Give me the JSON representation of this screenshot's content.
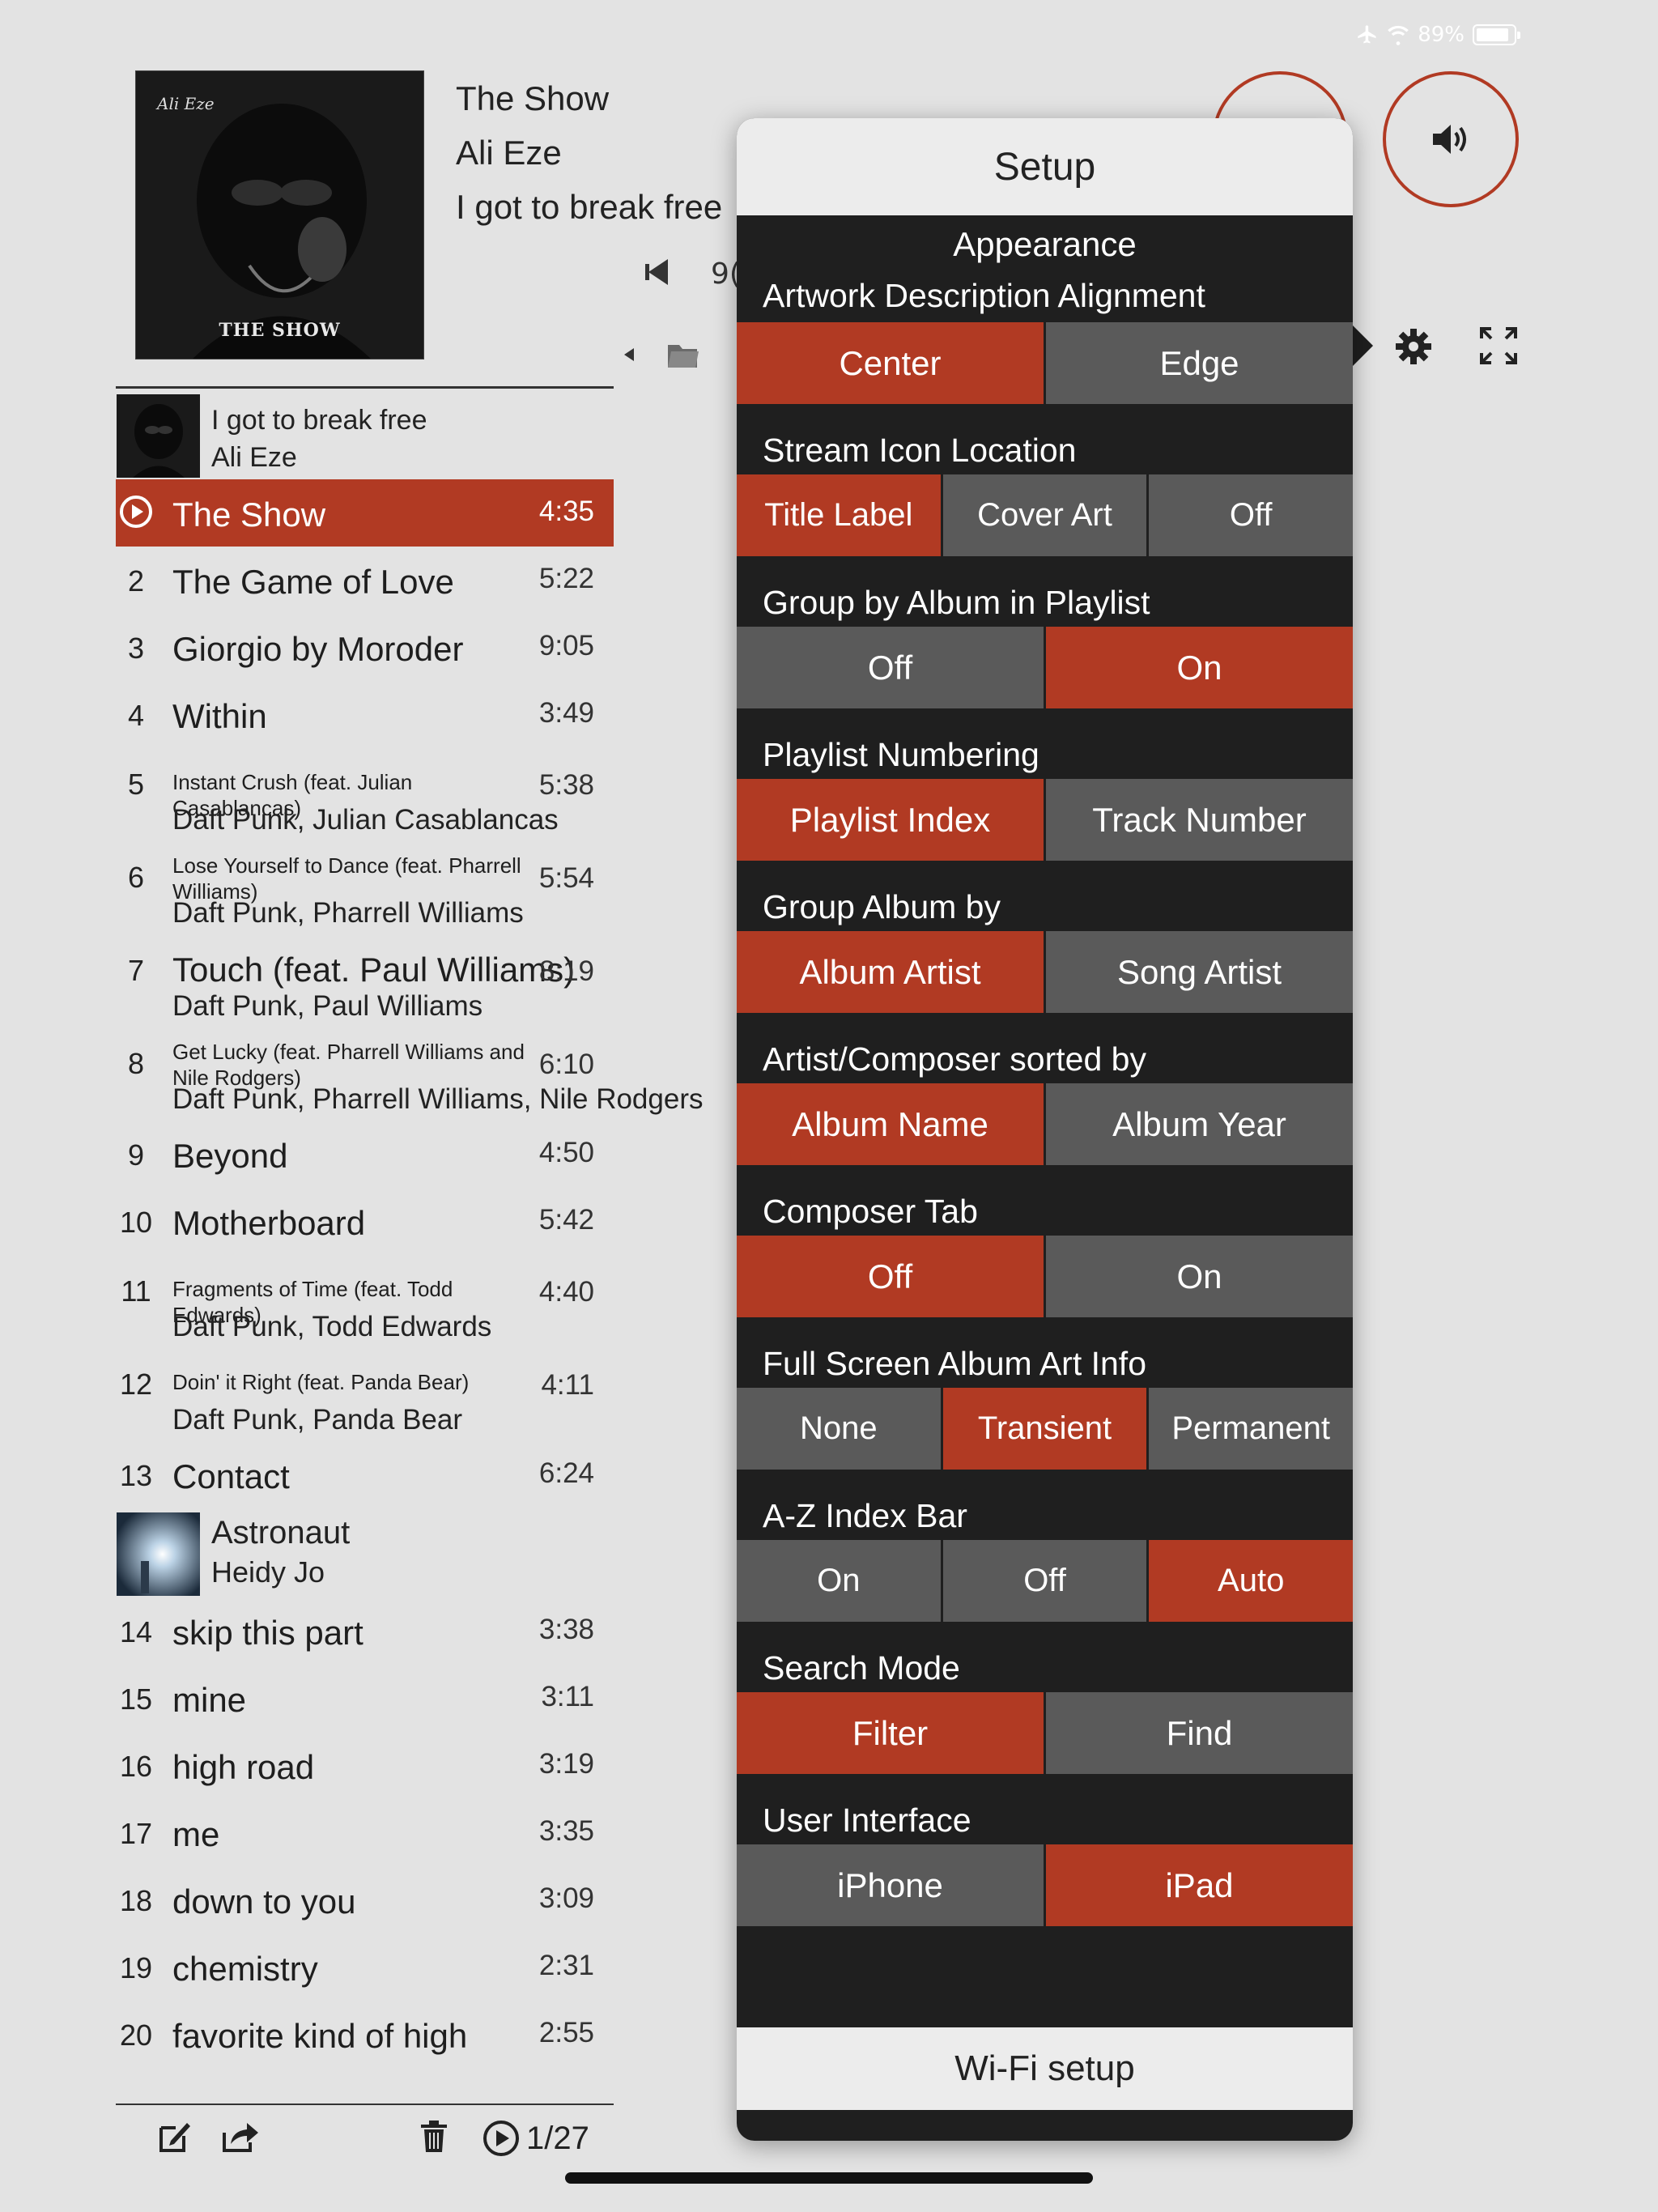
{
  "status": {
    "battery": "89%",
    "battery_level": 0.89,
    "icons": [
      "airplane-icon",
      "wifi-icon",
      "battery-icon"
    ]
  },
  "now_playing": {
    "title": "The Show",
    "artist": "Ali Eze",
    "album": "I got to break free",
    "partial_text": "9(",
    "cover_signature": "Ali Eze",
    "cover_caption": "THE SHOW"
  },
  "setup": {
    "title": "Setup",
    "appearance_label": "Appearance",
    "sections": [
      {
        "title": "Artwork Description Alignment",
        "options": [
          "Center",
          "Edge"
        ],
        "selected": 0
      },
      {
        "title": "Stream Icon Location",
        "options": [
          "Title Label",
          "Cover Art",
          "Off"
        ],
        "selected": 0
      },
      {
        "title": "Group by Album in Playlist",
        "options": [
          "Off",
          "On"
        ],
        "selected": 1
      },
      {
        "title": "Playlist Numbering",
        "options": [
          "Playlist Index",
          "Track Number"
        ],
        "selected": 0
      },
      {
        "title": "Group Album by",
        "options": [
          "Album Artist",
          "Song Artist"
        ],
        "selected": 0
      },
      {
        "title": "Artist/Composer sorted by",
        "options": [
          "Album Name",
          "Album Year"
        ],
        "selected": 0
      },
      {
        "title": "Composer Tab",
        "options": [
          "Off",
          "On"
        ],
        "selected": 0
      },
      {
        "title": "Full Screen Album Art Info",
        "options": [
          "None",
          "Transient",
          "Permanent"
        ],
        "selected": 1
      },
      {
        "title": "A-Z Index Bar",
        "options": [
          "On",
          "Off",
          "Auto"
        ],
        "selected": 2
      },
      {
        "title": "Search Mode",
        "options": [
          "Filter",
          "Find"
        ],
        "selected": 0
      },
      {
        "title": "User Interface",
        "options": [
          "iPhone",
          "iPad"
        ],
        "selected": 1
      }
    ],
    "wifi_label": "Wi-Fi setup"
  },
  "playlist": {
    "albums": [
      {
        "title": "I got to break free",
        "artist": "Ali Eze"
      },
      {
        "title": "Astronaut",
        "artist": "Heidy Jo"
      }
    ],
    "tracks": [
      {
        "num": "",
        "title": "The Show",
        "dur": "4:35",
        "current": true
      },
      {
        "num": "2",
        "title": "The Game of Love",
        "dur": "5:22"
      },
      {
        "num": "3",
        "title": "Giorgio by Moroder",
        "dur": "9:05"
      },
      {
        "num": "4",
        "title": "Within",
        "dur": "3:49"
      },
      {
        "num": "5",
        "title": "Instant Crush (feat. Julian Casablancas)",
        "dur": "5:38",
        "sub": "Daft Punk, Julian Casablancas",
        "small": true
      },
      {
        "num": "6",
        "title": "Lose Yourself to Dance (feat. Pharrell Williams)",
        "dur": "5:54",
        "sub": "Daft Punk, Pharrell Williams",
        "small": true,
        "wrap": true
      },
      {
        "num": "7",
        "title": "Touch (feat. Paul Williams)",
        "dur": "8:19",
        "sub": "Daft Punk, Paul Williams"
      },
      {
        "num": "8",
        "title": "Get Lucky (feat. Pharrell Williams and Nile Rodgers)",
        "dur": "6:10",
        "sub": "Daft Punk, Pharrell Williams, Nile Rodgers",
        "small": true,
        "wrap": true
      },
      {
        "num": "9",
        "title": "Beyond",
        "dur": "4:50"
      },
      {
        "num": "10",
        "title": "Motherboard",
        "dur": "5:42"
      },
      {
        "num": "11",
        "title": "Fragments of Time (feat. Todd Edwards)",
        "dur": "4:40",
        "sub": "Daft Punk, Todd Edwards",
        "small": true
      },
      {
        "num": "12",
        "title": "Doin' it Right (feat. Panda Bear)",
        "dur": "4:11",
        "sub": "Daft Punk, Panda Bear",
        "small": true
      },
      {
        "num": "13",
        "title": "Contact",
        "dur": "6:24"
      },
      {
        "num": "14",
        "title": "skip this part",
        "dur": "3:38"
      },
      {
        "num": "15",
        "title": "mine",
        "dur": "3:11"
      },
      {
        "num": "16",
        "title": "high road",
        "dur": "3:19"
      },
      {
        "num": "17",
        "title": "me",
        "dur": "3:35"
      },
      {
        "num": "18",
        "title": "down to you",
        "dur": "3:09"
      },
      {
        "num": "19",
        "title": "chemistry",
        "dur": "2:31"
      },
      {
        "num": "20",
        "title": "favorite kind of high",
        "dur": "2:55"
      }
    ],
    "count": "1/27"
  },
  "colors": {
    "accent": "#b13a23",
    "panel": "#1f1f1f",
    "segment_off": "#5a5a5a",
    "background": "#e3e3e3"
  }
}
